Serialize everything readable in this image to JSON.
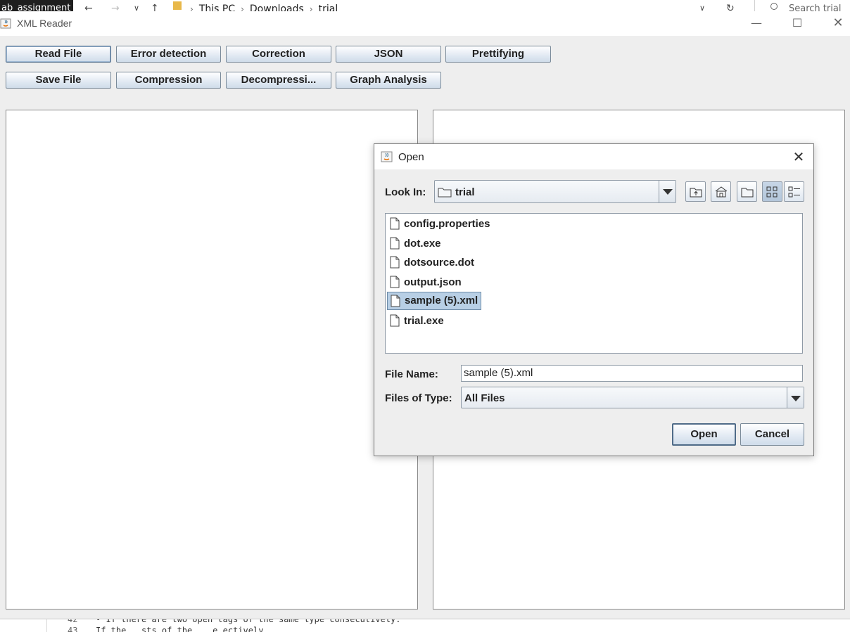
{
  "background": {
    "explorer": {
      "dark_tab_text": "ab_assignment",
      "breadcrumb": [
        "This PC",
        "Downloads",
        "trial"
      ],
      "search_placeholder": "Search trial"
    },
    "editor": {
      "lines": [
        {
          "num": "42",
          "text": "• If there are two open tags of the same type consecutively."
        },
        {
          "num": "43",
          "text": "  If the…                …sts of the …        …e…ectively."
        }
      ]
    }
  },
  "window": {
    "title": "XML Reader",
    "toolbar_row1": [
      "Read File",
      "Error detection",
      "Correction",
      "JSON",
      "Prettifying"
    ],
    "toolbar_row2": [
      "Save File",
      "Compression",
      "Decompressi...",
      "Graph Analysis"
    ]
  },
  "dialog": {
    "title": "Open",
    "look_in_label": "Look In:",
    "look_in_value": "trial",
    "files": [
      "config.properties",
      "dot.exe",
      "dotsource.dot",
      "output.json",
      "sample (5).xml",
      "trial.exe"
    ],
    "selected_file": "sample (5).xml",
    "file_name_label": "File Name:",
    "file_name_value": "sample (5).xml",
    "files_of_type_label": "Files of Type:",
    "files_of_type_value": "All Files",
    "open_button": "Open",
    "cancel_button": "Cancel"
  }
}
